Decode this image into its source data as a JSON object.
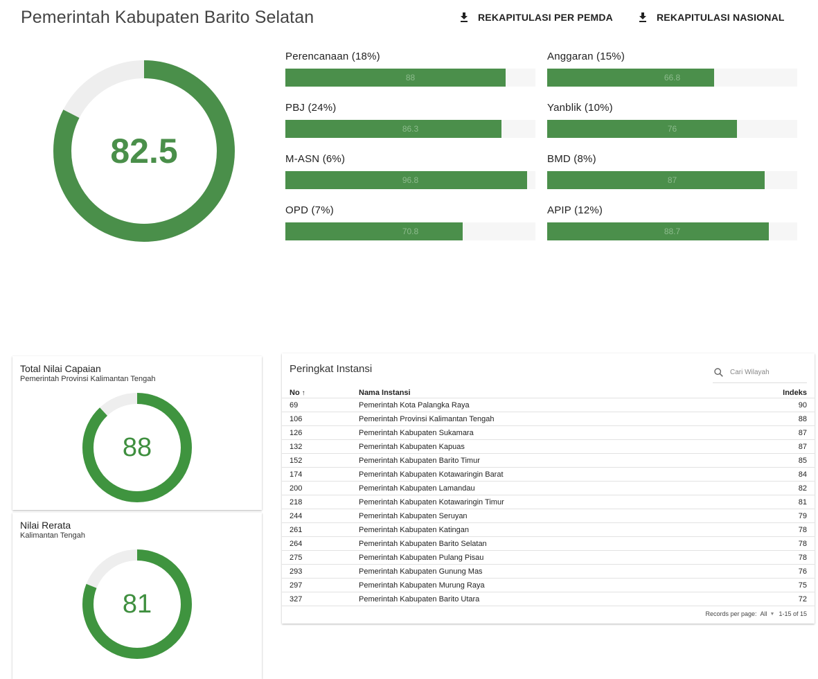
{
  "header": {
    "title": "Pemerintah Kabupaten Barito Selatan",
    "btn_pemda": "REKAPITULASI PER PEMDA",
    "btn_nasional": "REKAPITULASI NASIONAL",
    "download_icon": "download-icon"
  },
  "overall": {
    "score": "82.5",
    "value": 82.5,
    "max": 100
  },
  "colors": {
    "accent": "#4a8f4a",
    "track": "#eeeeee"
  },
  "categories": [
    {
      "label": "Perencanaan (18%)",
      "value": "88",
      "pct": 88
    },
    {
      "label": "Anggaran (15%)",
      "value": "66.8",
      "pct": 66.8
    },
    {
      "label": "PBJ (24%)",
      "value": "86.3",
      "pct": 86.3
    },
    {
      "label": "Yanblik (10%)",
      "value": "76",
      "pct": 76
    },
    {
      "label": "M-ASN (6%)",
      "value": "96.8",
      "pct": 96.8
    },
    {
      "label": "BMD (8%)",
      "value": "87",
      "pct": 87
    },
    {
      "label": "OPD (7%)",
      "value": "70.8",
      "pct": 70.8
    },
    {
      "label": "APIP (12%)",
      "value": "88.7",
      "pct": 88.7
    }
  ],
  "total_card": {
    "title": "Total Nilai Capaian",
    "subtitle": "Pemerintah Provinsi Kalimantan Tengah",
    "score": "88",
    "value": 88
  },
  "rerata_card": {
    "title": "Nilai Rerata",
    "subtitle": "Kalimantan Tengah",
    "score": "81",
    "value": 81
  },
  "ranking": {
    "title": "Peringkat Instansi",
    "search_placeholder": "Cari Wilayah",
    "columns": {
      "no": "No",
      "name": "Nama Instansi",
      "index": "Indeks"
    },
    "sort_icon": "arrow-up-icon",
    "rows": [
      {
        "no": "69",
        "name": "Pemerintah Kota Palangka Raya",
        "index": "90"
      },
      {
        "no": "106",
        "name": "Pemerintah Provinsi Kalimantan Tengah",
        "index": "88"
      },
      {
        "no": "126",
        "name": "Pemerintah Kabupaten Sukamara",
        "index": "87"
      },
      {
        "no": "132",
        "name": "Pemerintah Kabupaten Kapuas",
        "index": "87"
      },
      {
        "no": "152",
        "name": "Pemerintah Kabupaten Barito Timur",
        "index": "85"
      },
      {
        "no": "174",
        "name": "Pemerintah Kabupaten Kotawaringin Barat",
        "index": "84"
      },
      {
        "no": "200",
        "name": "Pemerintah Kabupaten Lamandau",
        "index": "82"
      },
      {
        "no": "218",
        "name": "Pemerintah Kabupaten Kotawaringin Timur",
        "index": "81"
      },
      {
        "no": "244",
        "name": "Pemerintah Kabupaten Seruyan",
        "index": "79"
      },
      {
        "no": "261",
        "name": "Pemerintah Kabupaten Katingan",
        "index": "78"
      },
      {
        "no": "264",
        "name": "Pemerintah Kabupaten Barito Selatan",
        "index": "78"
      },
      {
        "no": "275",
        "name": "Pemerintah Kabupaten Pulang Pisau",
        "index": "78"
      },
      {
        "no": "293",
        "name": "Pemerintah Kabupaten Gunung Mas",
        "index": "76"
      },
      {
        "no": "297",
        "name": "Pemerintah Kabupaten Murung Raya",
        "index": "75"
      },
      {
        "no": "327",
        "name": "Pemerintah Kabupaten Barito Utara",
        "index": "72"
      }
    ],
    "footer": {
      "records_label": "Records per page:",
      "per_page": "All",
      "range": "1-15 of 15"
    }
  }
}
